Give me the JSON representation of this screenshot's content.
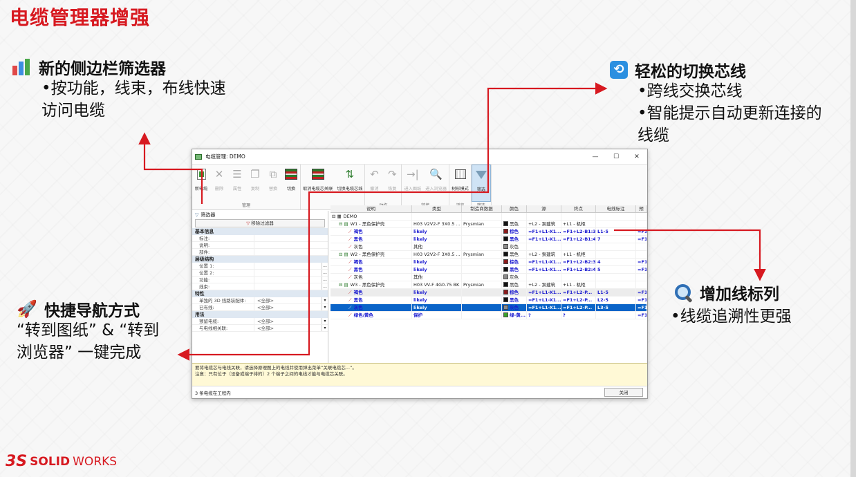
{
  "slide": {
    "title": "电缆管理器增强"
  },
  "features": {
    "sidebar": {
      "title": "新的侧边栏筛选器",
      "lines": [
        "•按功能，线束，布线快速",
        "访问电缆"
      ]
    },
    "switch": {
      "title": "轻松的切换芯线",
      "lines": [
        "•跨线交换芯线",
        "•智能提示自动更新连接的",
        "线缆"
      ]
    },
    "nav": {
      "title": "快捷导航方式",
      "lines": [
        "“转到图纸” & “转到",
        "浏览器” 一键完成"
      ]
    },
    "column": {
      "title": "增加线标列",
      "lines": [
        "•线缆追溯性更强"
      ]
    }
  },
  "window": {
    "title": "电缆管理: DEMO",
    "controls": [
      "—",
      "☐",
      "✕"
    ],
    "ribbon": {
      "groups": [
        {
          "label": "管理",
          "buttons": [
            {
              "label": "新电缆",
              "icon": "new-cable-icon",
              "disabled": false
            },
            {
              "label": "删除",
              "icon": "delete-icon",
              "disabled": true
            },
            {
              "label": "属性",
              "icon": "properties-icon",
              "disabled": true
            },
            {
              "label": "复制",
              "icon": "copy-icon",
              "disabled": true
            },
            {
              "label": "替换",
              "icon": "replace-icon",
              "disabled": true
            },
            {
              "label": "切换",
              "icon": "switch-icon",
              "disabled": false
            }
          ]
        },
        {
          "label": "",
          "buttons": [
            {
              "label": "取消电缆芯关联",
              "icon": "unlink-core-icon",
              "disabled": false
            },
            {
              "label": "切换电缆芯线",
              "icon": "switch-core-icon",
              "disabled": false
            }
          ]
        },
        {
          "label": "动作",
          "buttons": [
            {
              "label": "撤消",
              "icon": "undo-icon",
              "disabled": true
            },
            {
              "label": "恢复",
              "icon": "redo-icon",
              "disabled": true
            }
          ]
        },
        {
          "label": "链接",
          "buttons": [
            {
              "label": "进入图纸",
              "icon": "go-drawing-icon",
              "disabled": true
            },
            {
              "label": "进入浏览器",
              "icon": "go-browser-icon",
              "disabled": true
            }
          ]
        },
        {
          "label": "浏览",
          "buttons": [
            {
              "label": "树形模式",
              "icon": "tree-mode-icon",
              "disabled": false
            }
          ]
        },
        {
          "label": "筛选",
          "buttons": [
            {
              "label": "筛选",
              "icon": "filter-icon",
              "disabled": false
            }
          ]
        }
      ]
    },
    "filter_pane": {
      "header": "筛选器",
      "remove_label": "移除过滤器",
      "sections": [
        {
          "title": "基本信息",
          "rows": [
            {
              "k": "标注:",
              "v": ""
            },
            {
              "k": "说明:",
              "v": ""
            },
            {
              "k": "部件:",
              "v": ""
            }
          ]
        },
        {
          "title": "层级结构",
          "rows": [
            {
              "k": "位置 1:",
              "v": "",
              "btn": "..."
            },
            {
              "k": "位置 2:",
              "v": "",
              "btn": "..."
            },
            {
              "k": "功能:",
              "v": "",
              "btn": "..."
            },
            {
              "k": "线束:",
              "v": "",
              "btn": "..."
            }
          ]
        },
        {
          "title": "特性",
          "rows": [
            {
              "k": "单独的 3D 线路装配体:",
              "v": "<全部>",
              "btn": "▾"
            },
            {
              "k": "已布线:",
              "v": "<全部>",
              "btn": "▾"
            }
          ]
        },
        {
          "title": "用法",
          "rows": [
            {
              "k": "预留电缆:",
              "v": "<全部>",
              "btn": "▾"
            },
            {
              "k": "与电线相关联:",
              "v": "<全部>",
              "btn": "▾"
            }
          ]
        }
      ]
    },
    "grid": {
      "columns": [
        "说明",
        "类型",
        "制造商数据",
        "颜色",
        "源",
        "终点",
        "电线标注",
        "预"
      ],
      "rows": [
        {
          "d": "DEMO",
          "kind": "root",
          "t": "",
          "m": "",
          "c": "",
          "cc": "",
          "s": "",
          "e": "",
          "w": "",
          "p": ""
        },
        {
          "d": "W1 - 黑色保护壳",
          "kind": "cable",
          "t": "H03 V2V2-F 3X0.5 ...",
          "m": "Prysmian",
          "c": "黑色",
          "cc": "#111111",
          "s": "+L2 - 泵建筑",
          "e": "+L1 - 机柜",
          "w": "",
          "p": ""
        },
        {
          "d": "褐色",
          "kind": "core",
          "t": "likely",
          "m": "",
          "c": "棕色",
          "cc": "#8b1a1a",
          "s": "=F1+L1-X1...",
          "e": "=F1+L2-B1:3",
          "w": "L1-5",
          "p": "=F1+"
        },
        {
          "d": "黑色",
          "kind": "core",
          "t": "likely",
          "m": "",
          "c": "黑色",
          "cc": "#111111",
          "s": "=F1+L1-X1...",
          "e": "=F1+L2-B1:4",
          "w": "7",
          "p": "=F1+"
        },
        {
          "d": "灰色",
          "kind": "corep",
          "t": "其他",
          "m": "",
          "c": "灰色",
          "cc": "#8a8a8a",
          "s": "",
          "e": "",
          "w": "",
          "p": ""
        },
        {
          "d": "W2 - 黑色保护壳",
          "kind": "cable",
          "t": "H03 V2V2-F 3X0.5 ...",
          "m": "Prysmian",
          "c": "黑色",
          "cc": "#111111",
          "s": "+L2 - 泵建筑",
          "e": "+L1 - 机柜",
          "w": "",
          "p": ""
        },
        {
          "d": "褐色",
          "kind": "core",
          "t": "likely",
          "m": "",
          "c": "棕色",
          "cc": "#8b1a1a",
          "s": "=F1+L1-X1...",
          "e": "=F1+L2-B2:3",
          "w": "4",
          "p": "=F1+"
        },
        {
          "d": "黑色",
          "kind": "core",
          "t": "likely",
          "m": "",
          "c": "黑色",
          "cc": "#111111",
          "s": "=F1+L1-X1...",
          "e": "=F1+L2-B2:4",
          "w": "5",
          "p": "=F1+"
        },
        {
          "d": "灰色",
          "kind": "corep",
          "t": "其他",
          "m": "",
          "c": "灰色",
          "cc": "#8a8a8a",
          "s": "",
          "e": "",
          "w": "",
          "p": ""
        },
        {
          "d": "W3 - 黑色保护壳",
          "kind": "cable",
          "t": "H03 VV-F 4G0.75 BK",
          "m": "Prysmian",
          "c": "黑色",
          "cc": "#111111",
          "s": "+L2 - 泵建筑",
          "e": "+L1 - 机柜",
          "w": "",
          "p": ""
        },
        {
          "d": "褐色",
          "kind": "core",
          "hl": true,
          "t": "likely",
          "m": "",
          "c": "棕色",
          "cc": "#8b1a1a",
          "s": "=F1+L1-X1...",
          "e": "=F1+L2-P...",
          "w": "L1-5",
          "p": "=F1+"
        },
        {
          "d": "黑色",
          "kind": "core",
          "t": "likely",
          "m": "",
          "c": "黑色",
          "cc": "#111111",
          "s": "=F1+L1-X1...",
          "e": "=F1+L2-P...",
          "w": "L2-5",
          "p": "=F1+"
        },
        {
          "d": "灰色",
          "kind": "core",
          "sel": true,
          "t": "likely",
          "m": "",
          "c": "灰色",
          "cc": "#8a8a8a",
          "s": "=F1+L1-X1...",
          "e": "=F1+L2-P...",
          "w": "L3-5",
          "p": "=F1+"
        },
        {
          "d": "绿色/黄色",
          "kind": "core",
          "t": "保护",
          "m": "",
          "c": "绿-黄...",
          "cc": "#3aa02a",
          "s": "?",
          "e": "?",
          "w": "",
          "p": "=F1+"
        }
      ]
    },
    "info": {
      "line1": "要将电缆芯与电线关联，请选择原理图上的电线并使用弹出菜单“关联电缆芯...”。",
      "line2": "注意：只有位于（设备或端子排的）2 个端子之间的电线才能与电缆芯关联。"
    },
    "status": {
      "text": "3 条电缆在工程内",
      "close_label": "关闭"
    }
  },
  "logo": {
    "mark": "3S",
    "text_bold": "SOLID",
    "text_light": "WORKS"
  },
  "colors": {
    "accent": "#d71920",
    "arrow": "#d71920",
    "selection": "#0a64c8"
  }
}
